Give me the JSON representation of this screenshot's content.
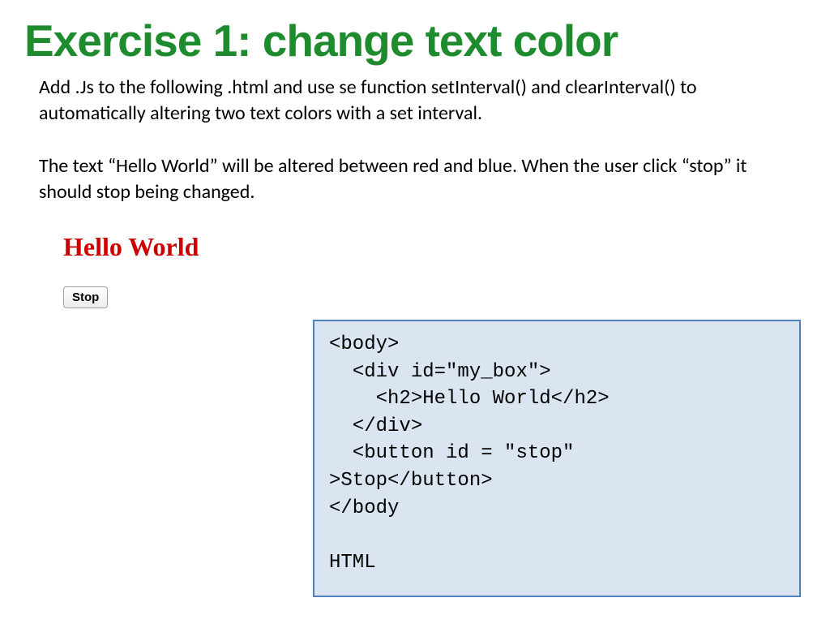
{
  "title": "Exercise 1: change text color",
  "paragraphs": {
    "p1": "Add .Js to the following .html  and use se function setInterval() and clearInterval() to automatically altering two text colors with a set interval.",
    "p2": "The text “Hello World” will be altered between red and blue. When the user click “stop” it should stop being changed."
  },
  "demo": {
    "heading": "Hello World",
    "stop_label": "Stop"
  },
  "code": "<body>\n  <div id=\"my_box\">\n    <h2>Hello World</h2>\n  </div>\n  <button id = \"stop\" \n>Stop</button>\n</body\n\nHTML",
  "colors": {
    "title_green": "#1f8b2f",
    "demo_red": "#cc0000",
    "code_bg": "#dbe5f1",
    "code_border": "#4f81bd"
  }
}
